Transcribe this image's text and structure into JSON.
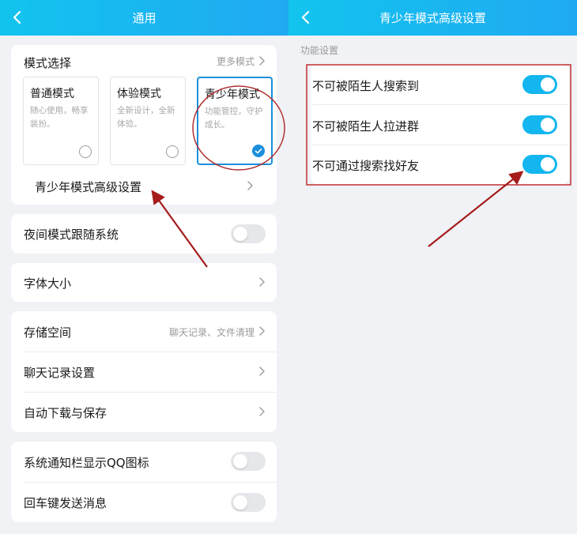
{
  "left": {
    "title": "通用",
    "mode": {
      "header": "模式选择",
      "more": "更多模式",
      "options": [
        {
          "title": "普通模式",
          "desc": "随心使用，畅享装扮。",
          "selected": false
        },
        {
          "title": "体验模式",
          "desc": "全新设计，全新体验。",
          "selected": false
        },
        {
          "title": "青少年模式",
          "desc": "功能管控，守护成长。",
          "selected": true
        }
      ],
      "advanced": "青少年模式高级设置"
    },
    "night": {
      "label": "夜间模式跟随系统",
      "on": false
    },
    "font": {
      "label": "字体大小"
    },
    "storage": {
      "label": "存储空间",
      "value": "聊天记录、文件清理"
    },
    "chat_settings": {
      "label": "聊天记录设置"
    },
    "auto_download": {
      "label": "自动下载与保存"
    },
    "notify_icon": {
      "label": "系统通知栏显示QQ图标",
      "on": false
    },
    "enter_send": {
      "label": "回车键发送消息",
      "on": false
    }
  },
  "right": {
    "title": "青少年模式高级设置",
    "section": "功能设置",
    "items": [
      {
        "label": "不可被陌生人搜索到",
        "on": true
      },
      {
        "label": "不可被陌生人拉进群",
        "on": true
      },
      {
        "label": "不可通过搜索找好友",
        "on": true
      }
    ]
  },
  "colors": {
    "header_gradient_start": "#12c4ee",
    "header_gradient_end": "#20a9f2",
    "toggle_on": "#13b6ee",
    "selected_mode": "#1b8fdc",
    "annotation_red": "#a61c1c"
  },
  "icons": [
    "back-arrow-icon",
    "chevron-right-icon",
    "checkmark-icon",
    "radio-empty-icon",
    "toggle-switch-icon"
  ]
}
